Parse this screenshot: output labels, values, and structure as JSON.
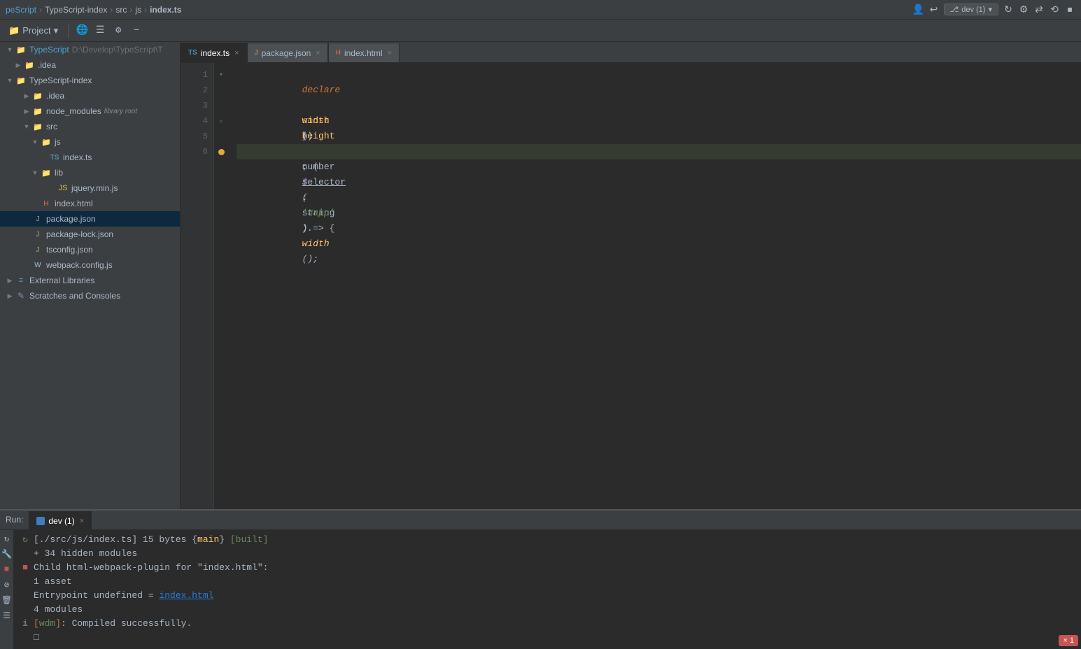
{
  "titlebar": {
    "breadcrumb": [
      "peScript",
      "TypeScript-index",
      "src",
      "js",
      "index.ts"
    ],
    "seps": [
      ">",
      ">",
      ">",
      ">"
    ],
    "branch_label": "dev (1)",
    "icons": [
      "profile",
      "back",
      "branch",
      "refresh",
      "settings",
      "sync",
      "revert",
      "stop"
    ]
  },
  "toolbar": {
    "project_label": "Project",
    "icons": [
      "earth",
      "align",
      "settings",
      "minus"
    ]
  },
  "sidebar": {
    "root_label": "TypeScript",
    "root_path": "D:\\Develop\\TypeScript\\T",
    "items": [
      {
        "id": "idea",
        "label": ".idea",
        "type": "folder",
        "indent": 2,
        "open": false
      },
      {
        "id": "typescript-index",
        "label": "TypeScript-index",
        "type": "folder",
        "indent": 1,
        "open": true
      },
      {
        "id": "idea2",
        "label": ".idea",
        "type": "folder",
        "indent": 3,
        "open": false
      },
      {
        "id": "node_modules",
        "label": "node_modules",
        "type": "folder-special",
        "indent": 3,
        "open": false,
        "badge": "library root"
      },
      {
        "id": "src",
        "label": "src",
        "type": "folder",
        "indent": 3,
        "open": true
      },
      {
        "id": "js",
        "label": "js",
        "type": "folder",
        "indent": 4,
        "open": true
      },
      {
        "id": "index_ts",
        "label": "index.ts",
        "type": "ts",
        "indent": 5,
        "selected": true
      },
      {
        "id": "lib",
        "label": "lib",
        "type": "folder",
        "indent": 4,
        "open": true
      },
      {
        "id": "jquery_min",
        "label": "jquery.min.js",
        "type": "js",
        "indent": 6
      },
      {
        "id": "index_html",
        "label": "index.html",
        "type": "html",
        "indent": 4
      },
      {
        "id": "package_json",
        "label": "package.json",
        "type": "json",
        "indent": 3,
        "selected2": true
      },
      {
        "id": "package_lock",
        "label": "package-lock.json",
        "type": "json",
        "indent": 3
      },
      {
        "id": "tsconfig_json",
        "label": "tsconfig.json",
        "type": "json",
        "indent": 3
      },
      {
        "id": "webpack_config",
        "label": "webpack.config.js",
        "type": "js",
        "indent": 3
      }
    ],
    "external_libs": "External Libraries",
    "scratches": "Scratches and Consoles"
  },
  "tabs": [
    {
      "id": "index_ts",
      "label": "index.ts",
      "type": "ts",
      "active": true,
      "modified": false
    },
    {
      "id": "package_json",
      "label": "package.json",
      "type": "json",
      "active": false,
      "modified": false
    },
    {
      "id": "index_html",
      "label": "index.html",
      "type": "html",
      "active": false,
      "modified": false
    }
  ],
  "code": {
    "lines": [
      {
        "num": 1,
        "content": "declare_kw",
        "text": "declare const $: (selector: string) => {"
      },
      {
        "num": 2,
        "content": "method",
        "text": "    width(): number;"
      },
      {
        "num": 3,
        "content": "method",
        "text": "    height(): number;"
      },
      {
        "num": 4,
        "content": "brace",
        "text": "}"
      },
      {
        "num": 5,
        "content": "empty",
        "text": ""
      },
      {
        "num": 6,
        "content": "call",
        "text": "$('#app').width();"
      }
    ]
  },
  "bottom_panel": {
    "run_tab_label": "Run:",
    "dev_tab_label": "dev (1)",
    "close_label": "×",
    "output_lines": [
      {
        "icon": "reload",
        "text": "[./src/js/index.ts] 15 bytes {main} [built]",
        "type": "info"
      },
      {
        "text": "    + 34 hidden modules",
        "type": "info",
        "indent": true
      },
      {
        "icon": "stop",
        "text": "Child html-webpack-plugin for \"index.html\":",
        "type": "error"
      },
      {
        "text": "        1 asset",
        "type": "info",
        "indent2": true
      },
      {
        "text": "    Entrypoint undefined = index.html",
        "type": "info",
        "indent": true,
        "link": "index.html"
      },
      {
        "text": "        4 modules",
        "type": "info",
        "indent2": true
      },
      {
        "icon": "info",
        "text": "i [wdm]: Compiled successfully.",
        "type": "success"
      }
    ]
  },
  "error_badge": {
    "count": "1",
    "icon": "×"
  }
}
